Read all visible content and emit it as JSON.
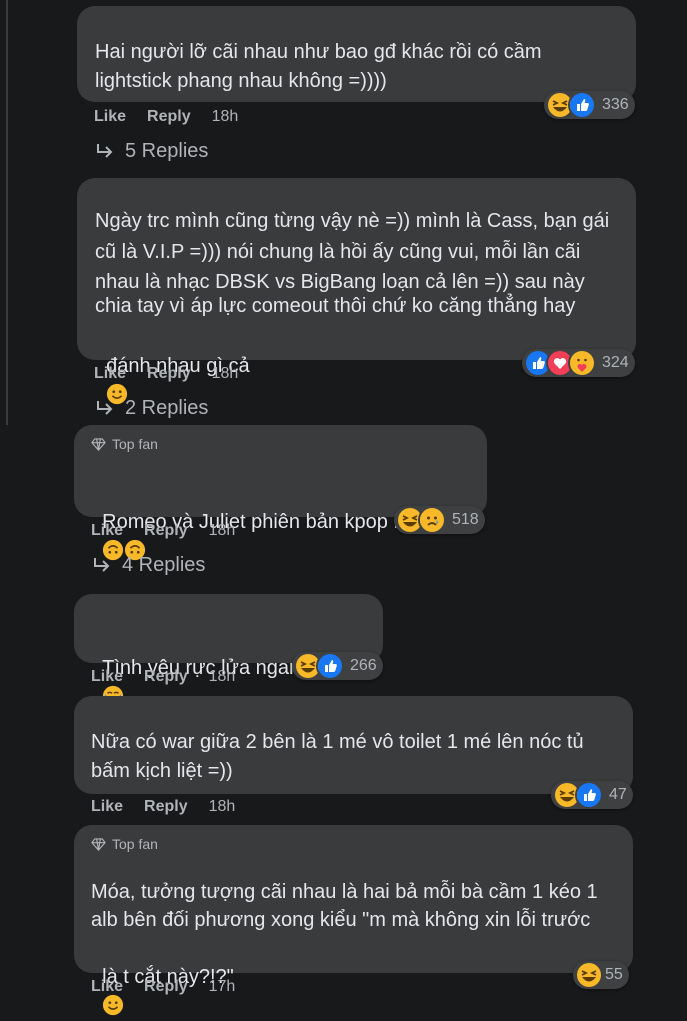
{
  "comments": [
    {
      "text_lines": [
        "Hai người lỡ cãi nhau như bao gđ khác rồi có cầm",
        "lightstick phang nhau không =))))"
      ],
      "reactions": [
        "haha-icon",
        "like-icon"
      ],
      "reaction_count": "336",
      "like_label": "Like",
      "reply_label": "Reply",
      "time": "18h",
      "replies_label": "5 Replies"
    },
    {
      "text_lines": [
        "Ngày trc mình cũng từng vậy nè =)) mình là Cass, bạn gái",
        "cũ là V.I.P =))) nói chung là hồi ấy cũng vui, mỗi lần cãi",
        "nhau là nhạc DBSK vs BigBang loạn cả lên =)) sau này",
        "chia tay vì áp lực comeout thôi chứ ko căng thẳng hay",
        "đánh nhau gì cả"
      ],
      "reactions": [
        "like-icon",
        "love-icon",
        "care-icon"
      ],
      "reaction_count": "324",
      "like_label": "Like",
      "reply_label": "Reply",
      "time": "18h",
      "replies_label": "2 Replies"
    },
    {
      "badge": "Top fan",
      "text_lines": [
        "Romeo và Juliet phiên bản kpop HE"
      ],
      "reactions": [
        "haha-icon",
        "sad-icon"
      ],
      "reaction_count": "518",
      "like_label": "Like",
      "reply_label": "Reply",
      "time": "18h",
      "replies_label": "4 Replies"
    },
    {
      "text_lines": [
        "Tình yêu rực lửa ngang trái"
      ],
      "reactions": [
        "haha-icon",
        "like-icon"
      ],
      "reaction_count": "266",
      "like_label": "Like",
      "reply_label": "Reply",
      "time": "18h"
    },
    {
      "text_lines": [
        "Nữa có war giữa 2 bên là 1 mé vô toilet 1 mé lên nóc tủ",
        "bấm kịch liệt =))"
      ],
      "reactions": [
        "haha-icon",
        "like-icon"
      ],
      "reaction_count": "47",
      "like_label": "Like",
      "reply_label": "Reply",
      "time": "18h"
    },
    {
      "badge": "Top fan",
      "text_lines": [
        "Móa, tưởng tượng cãi nhau là hai bả mỗi bà cầm 1 kéo 1",
        "alb bên đối phương xong kiểu \"m mà không xin lỗi trước",
        "là t cắt này?!?\""
      ],
      "reactions": [
        "haha-icon"
      ],
      "reaction_count": "55",
      "like_label": "Like",
      "reply_label": "Reply",
      "time": "17h"
    }
  ],
  "colors": {
    "background": "#18191a",
    "bubble": "#3a3b3c",
    "text": "#e4e6eb",
    "secondary": "#b0b3b8",
    "like_blue": "#1877f2",
    "love_red": "#f33e58",
    "emoji_yellow": "#f7b928"
  }
}
